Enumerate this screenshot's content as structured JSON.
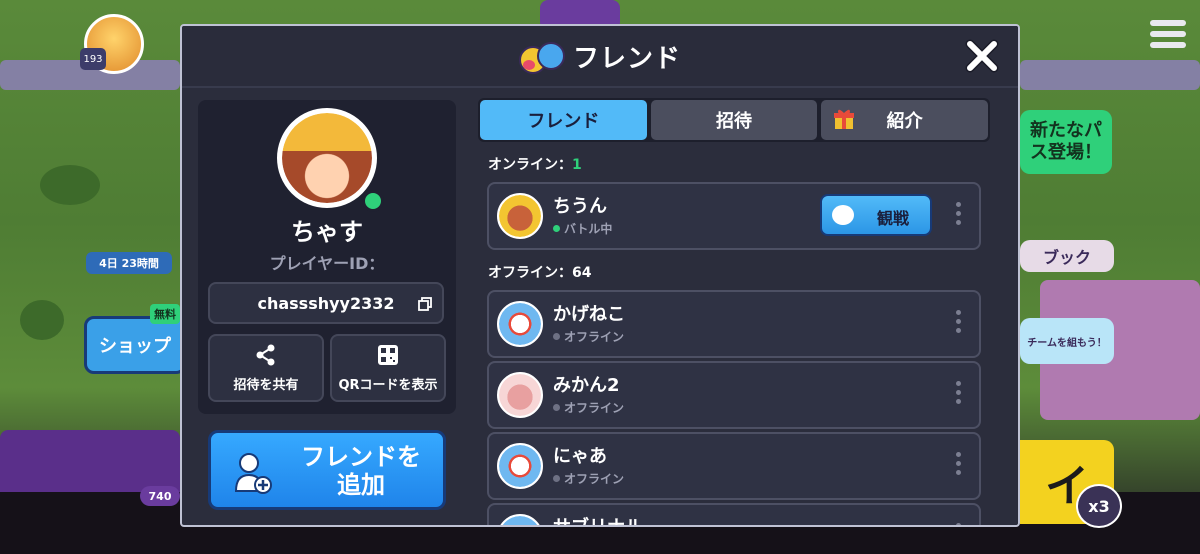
{
  "background": {
    "player_level": "193",
    "event_timer": "4日 23時間",
    "shop_label": "ショップ",
    "shop_badge": "無料",
    "pass_banner": "新たなパス登場！",
    "book_label": "ブック",
    "team_hint": "チームを組もう！",
    "trophy_count": "740",
    "play_fragment": "イ",
    "multiplier": "x3"
  },
  "modal": {
    "title": "フレンド",
    "close_label": "close"
  },
  "profile": {
    "name": "ちゃす",
    "player_id_label": "プレイヤーID：",
    "player_id": "chassshyy2332",
    "share_invite_label": "招待を共有",
    "qr_code_label": "QRコードを表示",
    "add_friend_label": "フレンドを\n追加"
  },
  "tabs": [
    {
      "label": "フレンド",
      "active": true
    },
    {
      "label": "招待",
      "active": false
    },
    {
      "label": "紹介",
      "active": false
    }
  ],
  "online_section": {
    "label": "オンライン：",
    "count": "1"
  },
  "offline_section": {
    "label": "オフライン：",
    "count": "64"
  },
  "online_friends": [
    {
      "name": "ちうん",
      "status": "バトル中",
      "action": "観戦"
    }
  ],
  "offline_friends": [
    {
      "name": "かげねこ",
      "status": "オフライン"
    },
    {
      "name": "みかん2",
      "status": "オフライン"
    },
    {
      "name": "にゃあ",
      "status": "オフライン"
    },
    {
      "name": "サブリナル",
      "status": ""
    }
  ],
  "colors": {
    "accent_blue": "#52baf8",
    "online_green": "#2fd07a",
    "panel_bg": "#2b2d3c"
  }
}
